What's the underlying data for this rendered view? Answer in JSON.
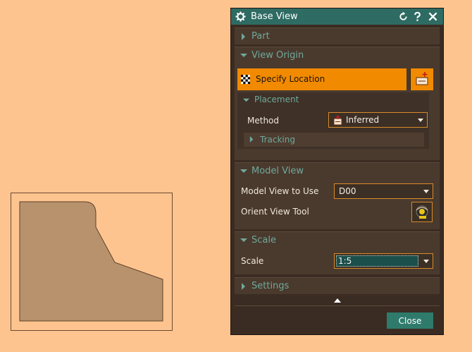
{
  "dialog": {
    "title": "Base View",
    "sections": {
      "part": {
        "label": "Part"
      },
      "view_origin": {
        "label": "View Origin",
        "specify_location": "Specify Location",
        "placement": {
          "label": "Placement",
          "method_label": "Method",
          "method_value": "Inferred",
          "tracking_label": "Tracking"
        }
      },
      "model_view": {
        "label": "Model View",
        "model_view_label": "Model View to Use",
        "model_view_value": "D00",
        "orient_tool_label": "Orient View Tool"
      },
      "scale": {
        "label": "Scale",
        "scale_label": "Scale",
        "scale_value": "1:5"
      },
      "settings": {
        "label": "Settings"
      }
    },
    "close_label": "Close"
  },
  "colors": {
    "background": "#fec48f",
    "dialog_bg": "#3a2c22",
    "titlebar": "#2e6b62",
    "accent_orange": "#f28a00",
    "section_label": "#6fa89c",
    "part_fill": "#b8926c"
  },
  "icons": {
    "title": "gear-icon",
    "reset": "reset-icon",
    "help": "help-icon",
    "close": "close-icon",
    "specify": "checker-icon",
    "point_dialog": "point-dialog-icon",
    "method": "inferred-point-icon",
    "orient": "orient-view-icon"
  }
}
